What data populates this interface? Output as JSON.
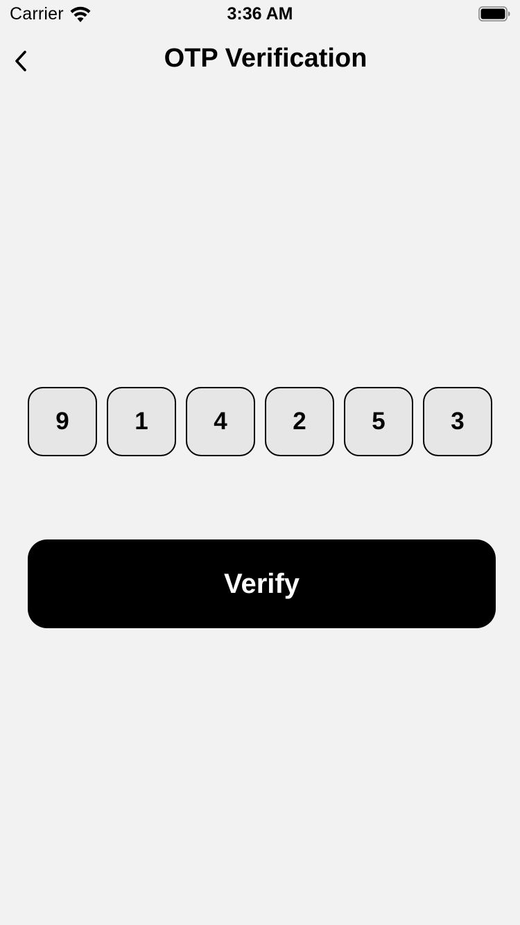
{
  "status_bar": {
    "carrier": "Carrier",
    "time": "3:36 AM",
    "wifi_icon": "wifi-icon",
    "battery_icon": "battery-icon"
  },
  "nav": {
    "back_icon": "chevron-left-icon",
    "title": "OTP Verification"
  },
  "otp": {
    "digits": [
      "9",
      "1",
      "4",
      "2",
      "5",
      "3"
    ]
  },
  "verify_button": {
    "label": "Verify",
    "background": "#000000",
    "text_color": "#ffffff"
  },
  "colors": {
    "background": "#f2f2f2",
    "otp_box_fill": "#e6e6e6"
  }
}
